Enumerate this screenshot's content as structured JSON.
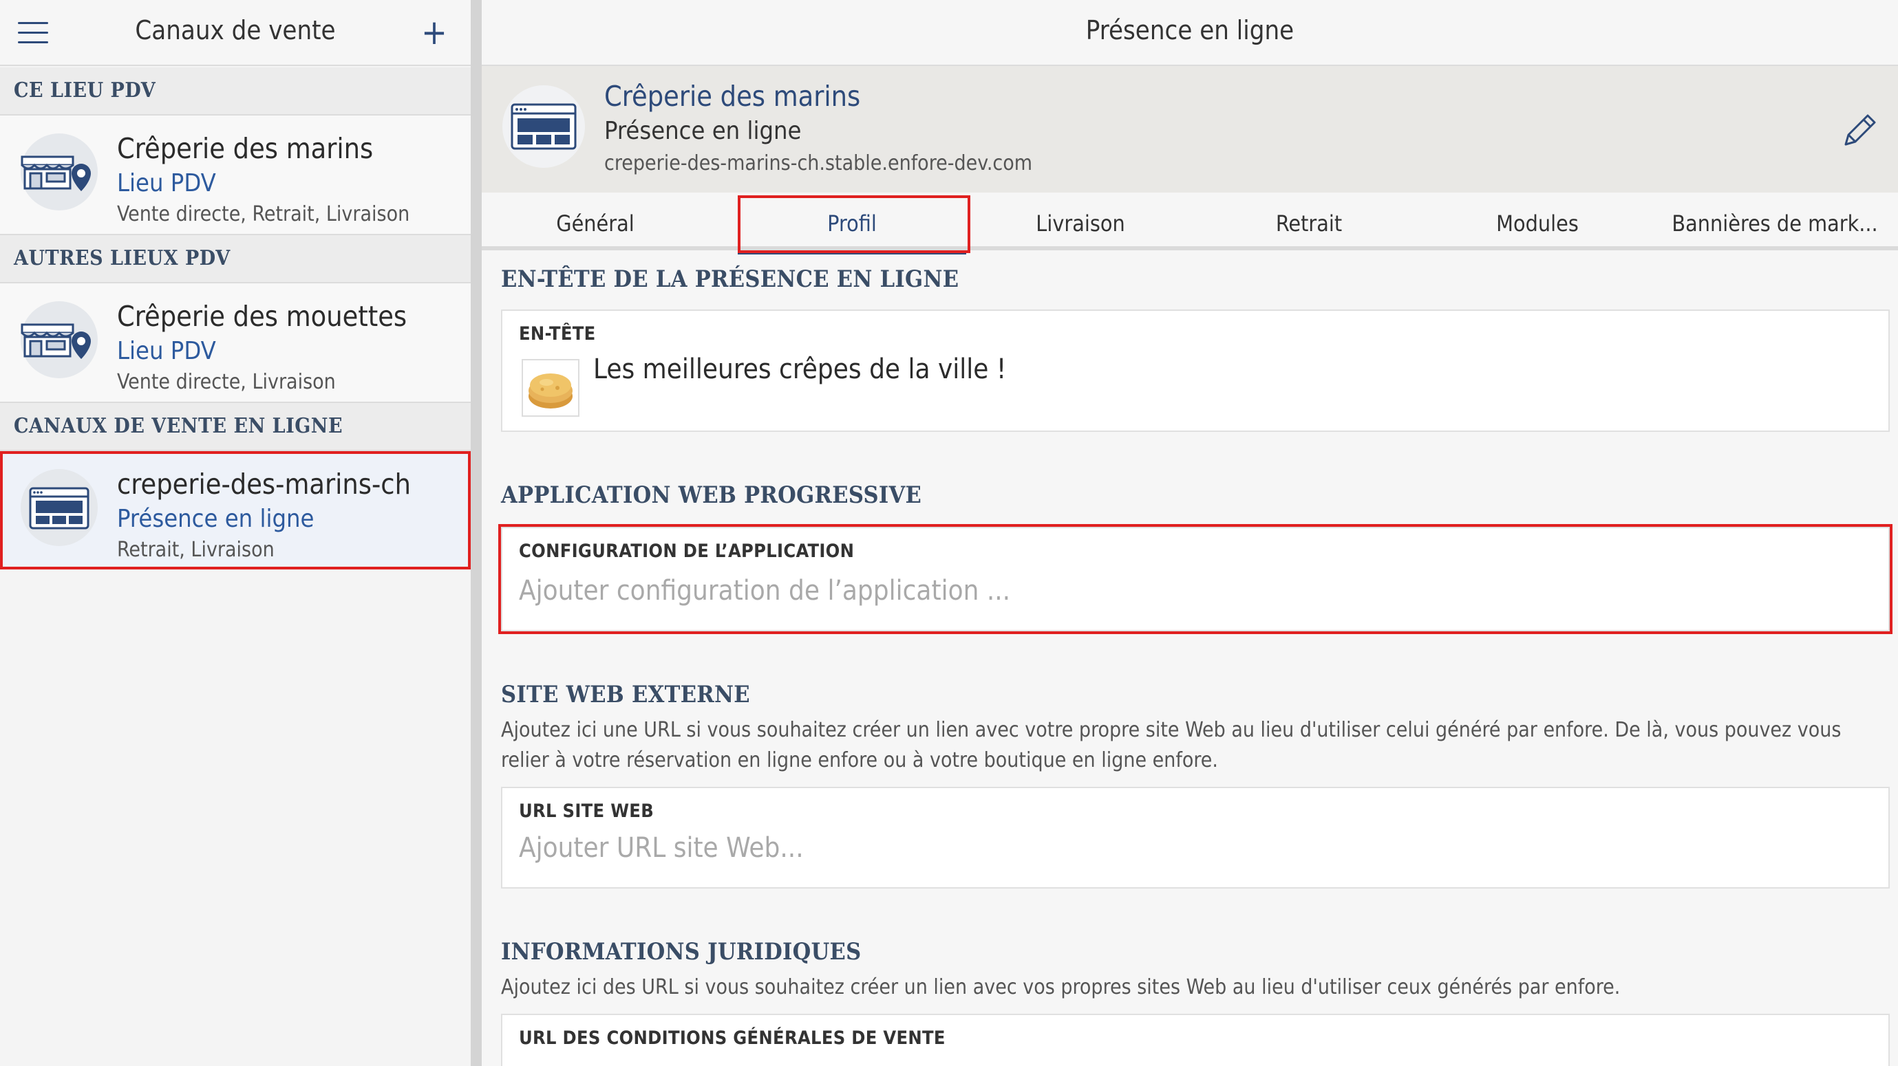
{
  "left": {
    "title": "Canaux de vente",
    "sections": {
      "this_pdv": "CE LIEU PDV",
      "other_pdv": "AUTRES LIEUX PDV",
      "online": "CANAUX DE VENTE EN LIGNE"
    },
    "items": [
      {
        "name": "Crêperie des marins",
        "type": "Lieu PDV",
        "services": "Vente directe, Retrait, Livraison"
      },
      {
        "name": "Crêperie des mouettes",
        "type": "Lieu PDV",
        "services": "Vente directe, Livraison"
      },
      {
        "name": "creperie-des-marins-ch",
        "type": "Présence en ligne",
        "services": "Retrait, Livraison"
      }
    ]
  },
  "right": {
    "title": "Présence en ligne",
    "banner": {
      "name": "Crêperie des marins",
      "type": "Présence en ligne",
      "url": "creperie-des-marins-ch.stable.enfore-dev.com"
    },
    "tabs": [
      "Général",
      "Profil",
      "Livraison",
      "Retrait",
      "Modules",
      "Bannières de mark..."
    ],
    "active_tab": "Profil",
    "sections": {
      "header": {
        "title": "EN-TÊTE DE LA PRÉSENCE EN LIGNE",
        "label": "EN-TÊTE",
        "value": "Les meilleures crêpes de la ville !"
      },
      "pwa": {
        "title": "APPLICATION WEB PROGRESSIVE",
        "label": "CONFIGURATION DE L’APPLICATION",
        "placeholder": "Ajouter configuration de l’application ..."
      },
      "external": {
        "title": "SITE WEB EXTERNE",
        "desc": "Ajoutez ici une URL si vous souhaitez créer un lien avec votre propre site Web au lieu d'utiliser celui généré par enfore. De là, vous pouvez vous relier à votre réservation en ligne enfore ou à votre boutique en ligne enfore.",
        "label": "URL SITE WEB",
        "placeholder": "Ajouter URL site Web..."
      },
      "legal": {
        "title": "INFORMATIONS JURIDIQUES",
        "desc": "Ajoutez ici des URL si vous souhaitez créer un lien avec vos propres sites Web au lieu d'utiliser ceux générés par enfore.",
        "label": "URL DES CONDITIONS GÉNÉRALES DE VENTE"
      }
    }
  },
  "colors": {
    "accent": "#2d4a7a",
    "link_blue": "#2d5a9e",
    "highlight": "#e02020"
  },
  "icons": [
    "menu-icon",
    "plus-icon",
    "store-location-icon",
    "web-browser-icon",
    "pencil-icon",
    "crepe-image"
  ]
}
